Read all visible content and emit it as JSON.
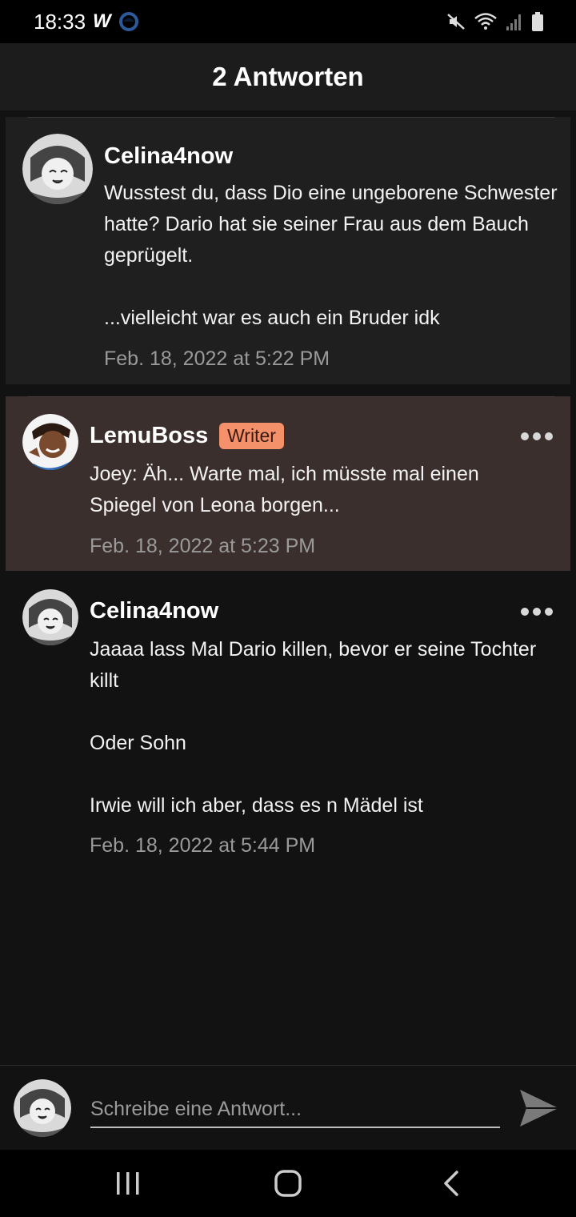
{
  "status_bar": {
    "time": "18:33",
    "app_icon_letter": "W",
    "icons": [
      "mute-icon",
      "wifi-icon",
      "signal-icon",
      "battery-icon"
    ]
  },
  "header": {
    "title": "2 Antworten"
  },
  "comments": [
    {
      "username": "Celina4now",
      "text": "Wusstest du, dass Dio eine ungeborene Schwester hatte? Dario hat sie seiner Frau aus dem Bauch geprügelt.\n\n...vielleicht war es auch ein Bruder idk",
      "timestamp": "Feb. 18, 2022 at 5:22 PM"
    },
    {
      "username": "LemuBoss",
      "badge": "Writer",
      "text": "Joey: Äh... Warte mal, ich müsste mal einen Spiegel von Leona borgen...",
      "timestamp": "Feb. 18, 2022 at 5:23 PM"
    },
    {
      "username": "Celina4now",
      "text": "Jaaaa lass Mal Dario killen, bevor er seine Tochter killt\n\nOder Sohn\n\nIrwie will ich aber, dass es n Mädel ist",
      "timestamp": "Feb. 18, 2022 at 5:44 PM"
    }
  ],
  "composer": {
    "placeholder": "Schreibe eine Antwort..."
  },
  "colors": {
    "highlight_bg": "#3a2f2d",
    "badge_bg": "#f4906a",
    "page_bg": "#121212"
  }
}
